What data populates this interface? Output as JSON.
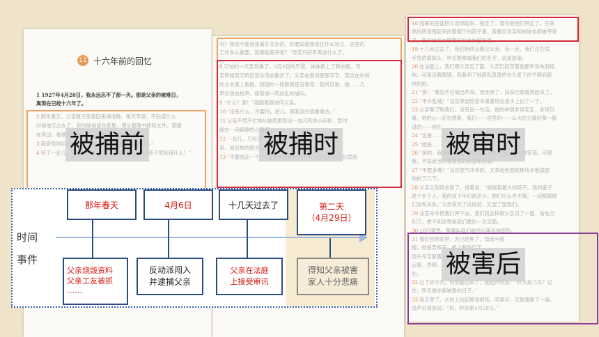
{
  "left_page": {
    "chapter_no": "11",
    "title": "十六年前的回忆",
    "para1": "1  1927年4月28日，我永远忘不了那一天。那是父亲的被难日，",
    "para1b": "离现在已经十六年了。",
    "lines": [
      {
        "n": "2",
        "t": "那年春天，父亲每天夜里回来得很晚。每天早晨，不知道什么"
      },
      {
        "n": "",
        "t": "时候他又出去了。有时候他留在家里，埋头整理书籍和文件。我蹲"
      },
      {
        "n": "",
        "t": "在旁边，看他把书和一沓一沓的文件放进炉子里。"
      },
      {
        "n": "3",
        "t": "我奇怪地问他：“爸，为什么要烧掉呢？怪可惜的。”"
      },
      {
        "n": "4",
        "t": "待了一会儿，父亲才回答：“不要了就烧掉。你小孩子家知道什么！”"
      }
    ]
  },
  "middle_page": {
    "top_lines": [
      "吗？我是不能轻易离开北京的。你要知道我是在什么地方，这里的",
      "工作多么重要。我哪能离开呢？”母亲只好不再说什么了。"
    ],
    "lines": [
      {
        "n": "8",
        "t": "可怕的一天果然来了。4月6日的早晨，妹妹换上了新衣服，母"
      },
      {
        "n": "",
        "t": "亲带她到天桥逛游乐场去散步了。父亲在里间屋里写字，我坐在外间"
      },
      {
        "n": "",
        "t": "的长木凳上看报。短短的一段新闻还没看完，就听见啪，啪……几"
      },
      {
        "n": "",
        "t": "声尖锐的枪声，接着是一阵纷乱的喊叫。"
      },
      {
        "n": "9",
        "t": "“什么？爹！”我跑着跑进问父亲。"
      },
      {
        "n": "10",
        "t": "“没有什么，不要怕。星儿，跟我到外面看看去。”"
      },
      {
        "n": "11",
        "t": "父亲不慌不忙地从抽屉里取出一支闪亮的小手枪，暂时"
      },
      {
        "n": "",
        "t": "躲在一间僻静的小屋里。"
      },
      {
        "n": "12",
        "t": "一会儿，只听见一阵沉重的皮鞋声，像地洞动起"
      },
      {
        "n": "",
        "t": "来，用恐怖的眼光……"
      },
      {
        "n": "13",
        "t": "“不要放走一个！”窗外响起粗暴的吼声。穿灰制服和长筒皮"
      }
    ]
  },
  "right_page": {
    "lines": [
      {
        "n": "18",
        "t": "残暴的匪徒把父亲绑起来，拖走了。我也被他们带走了。在高"
      },
      {
        "n": "",
        "t": "高的砖墙围起来的警察厅的院子里，我看见母亲和妹妹也都被带来"
      },
      {
        "n": "",
        "t": "了。我们被关在警察厅的女拘留所里。"
      },
      {
        "n": "19",
        "t": "十几天过去了。我们始终没看见父亲。有一天，我们正在啃"
      },
      {
        "n": "",
        "t": "手里的窝窝头，听见警察喊我们的名字，说是提审。"
      },
      {
        "n": "20",
        "t": "在法庭上，我们跟父亲见了面。父亲仍旧穿着他那件灰布旧棉"
      },
      {
        "n": "",
        "t": "袍，可是没戴眼镜。我看到了他那乱蓬蓬的长头发下的平静而慈"
      },
      {
        "n": "",
        "t": "祥的脸。"
      },
      {
        "n": "21",
        "t": "“爹！”我忍不住喊出声来。母亲哭了，妹妹也跟着哭起来了。"
      },
      {
        "n": "22",
        "t": "“不许乱喊！”法官拿起惊堂木重重地在桌子上拍了一下。"
      },
      {
        "n": "23",
        "t": "父亲瞅了瞅我们，没有说一句话。他的神情非常安定，非常沉"
      },
      {
        "n": "",
        "t": "着。他的心一定在想着，我们一一这里的一一么大的力量好像一股"
      },
      {
        "n": "",
        "t": "讲的一一他在……"
      },
      {
        "n": "24",
        "t": "“这是……"
      },
      {
        "n": "25",
        "t": "“她是……"
      },
      {
        "n": "26",
        "t": "“是的，我是最大的。”我怕父亲也在一审，就这样答道。可是"
      },
      {
        "n": "",
        "t": "我，不知道当时哪里来的机智和勇敢。"
      },
      {
        "n": "27",
        "t": "“不要多嘴！”法官怒气冲冲的，又拿起他面前那块木板狠狠"
      },
      {
        "n": "",
        "t": "地拍了几下。"
      },
      {
        "n": "28",
        "t": "父亲立刻就会意了，接着说：“她是我最大的孩子。我的妻子"
      },
      {
        "n": "",
        "t": "是个乡下人。我的孩子年纪都还小，她们什么也不懂。一切都跟她"
      },
      {
        "n": "",
        "t": "们没有关系。”父亲说完了这段话，又望了望我们。"
      },
      {
        "n": "29",
        "t": "法官命令把我们押下去。我们就这样跟父亲见了一面，匆匆分"
      },
      {
        "n": "",
        "t": "别了。想不到这竟是我们最后一次见面。"
      },
      {
        "n": "30",
        "t": "28日黄昏，警察叫我们收拾行李出拘留所。"
      },
      {
        "n": "31",
        "t": "我们回到家里，天已经黑了，母亲叫我"
      },
      {
        "n": "",
        "t": "报。他是男孩子，报上有四行字……"
      },
      {
        "n": "",
        "t": "用头号字登着……"
      },
      {
        "n": "",
        "t": "云雾，昏倒……"
      },
      {
        "n": "",
        "t": "烈。"
      },
      {
        "n": "32",
        "t": "过了好半天，母亲醒过来了，她低声问我：“昨天是几号？记"
      },
      {
        "n": "",
        "t": "住，昨天是你爹被害的日子。”"
      },
      {
        "n": "33",
        "t": "我又哭了。从地上捡起那张报纸，咬紧牙，又勉强看了一遍。"
      },
      {
        "n": "",
        "t": "低声对母亲说：“妈，昨天是4月28日。”"
      }
    ]
  },
  "labels": {
    "before_arrest": "被捕前",
    "during_arrest": "被捕时",
    "during_trial": "被审时",
    "after_death": "被害后"
  },
  "timeline": {
    "row_time": "时间",
    "row_event": "事件",
    "times": [
      "那年春天",
      "4月6日",
      "十几天过去了",
      "第二天\n（4月29日）"
    ],
    "events": [
      "父亲烧毁资料\n父亲工友被抓\n……",
      "反动派闯入\n并逮捕父亲",
      "父亲在法庭\n上接受审讯",
      "得知父亲被害\n家人十分悲痛"
    ]
  }
}
